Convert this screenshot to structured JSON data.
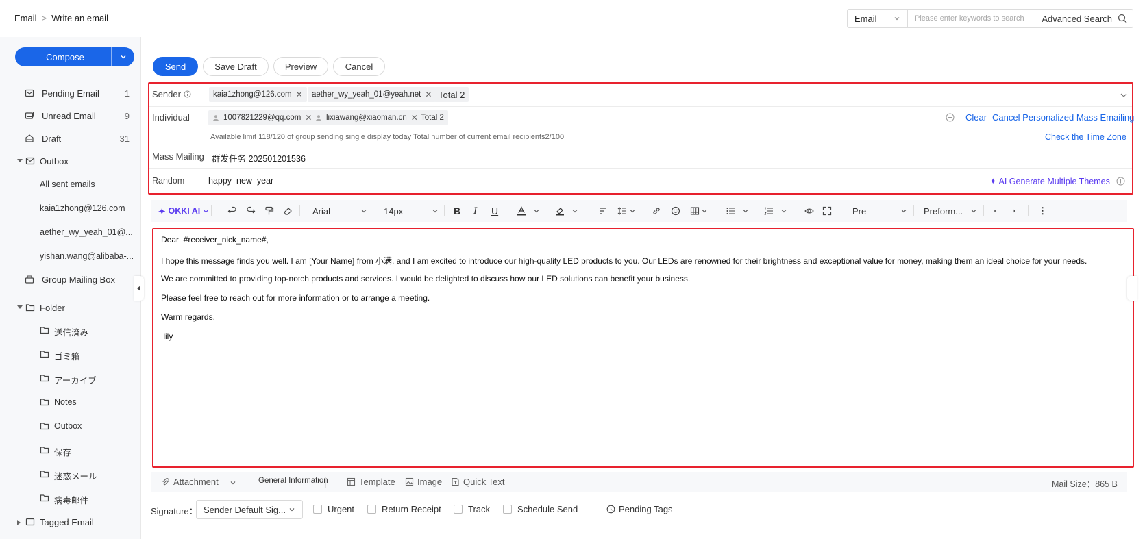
{
  "breadcrumb": {
    "root": "Email",
    "sep": ">",
    "current": "Write an email"
  },
  "search": {
    "scope": "Email",
    "placeholder": "Please enter keywords to search",
    "advanced": "Advanced Search"
  },
  "sidebar": {
    "compose": "Compose",
    "items": [
      {
        "label": "Pending Email",
        "count": "1",
        "icon": "pending-mail-icon"
      },
      {
        "label": "Unread Email",
        "count": "9",
        "icon": "unread-mail-icon"
      },
      {
        "label": "Draft",
        "count": "31",
        "icon": "draft-icon"
      },
      {
        "label": "Outbox",
        "count": "",
        "icon": "outbox-icon"
      }
    ],
    "outbox_sub": [
      "All sent emails",
      "kaia1zhong@126.com",
      "aether_wy_yeah_01@...",
      "yishan.wang@alibaba-..."
    ],
    "group_mailing": "Group Mailing Box",
    "folder": "Folder",
    "folders": [
      "送信済み",
      "ゴミ箱",
      "アーカイブ",
      "Notes",
      "Outbox",
      "保存",
      "迷惑メール",
      "病毒邮件"
    ],
    "tagged": "Tagged Email"
  },
  "actions": {
    "send": "Send",
    "save_draft": "Save Draft",
    "preview": "Preview",
    "cancel": "Cancel"
  },
  "header": {
    "sender_label": "Sender",
    "senders": [
      "kaia1zhong@126.com",
      "aether_wy_yeah_01@yeah.net"
    ],
    "sender_total": "Total 2",
    "individual_label": "Individual",
    "recipients": [
      "1007821229@qq.com",
      "lixiawang@xiaoman.cn"
    ],
    "recipient_total": "Total 2",
    "clear": "Clear",
    "cancel_personalized": "Cancel Personalized Mass Emailing",
    "limit_note": "Available limit 118/120 of group sending single display today Total number of current email recipients2/100",
    "time_zone": "Check the Time Zone",
    "mass_label": "Mass Mailing",
    "mass_value": "群发任务 202501201536",
    "random_label": "Random",
    "random_value": "happy  new  year",
    "ai_themes": "AI Generate Multiple Themes"
  },
  "toolbar": {
    "ai": "OKKI AI",
    "font": "Arial",
    "size": "14px",
    "block": "Pre",
    "format": "Preform..."
  },
  "body": {
    "lines": [
      "Dear  #receiver_nick_name#,",
      "I hope this message finds you well. I am [Your Name] from 小满, and I am excited to introduce our high-quality LED products to you. Our LEDs are renowned for their brightness and exceptional value for money, making them an ideal choice for your needs.",
      "We are committed to providing top-notch products and services. I would be delighted to discuss how our LED solutions can benefit your business.",
      "Please feel free to reach out for more information or to arrange a meeting.",
      "Warm regards,",
      " lily"
    ]
  },
  "bottom": {
    "attachment": "Attachment",
    "general": "General Information",
    "template": "Template",
    "image": "Image",
    "quick_text": "Quick Text",
    "mail_size": "Mail Size：865 B"
  },
  "options": {
    "signature_label": "Signature：",
    "signature_value": "Sender Default Sig...",
    "urgent": "Urgent",
    "return_receipt": "Return Receipt",
    "track": "Track",
    "schedule": "Schedule Send",
    "pending_tags": "Pending Tags"
  },
  "colors": {
    "accent": "#1a66e8",
    "highlight": "#e8222e",
    "ai": "#5b3cf0"
  }
}
